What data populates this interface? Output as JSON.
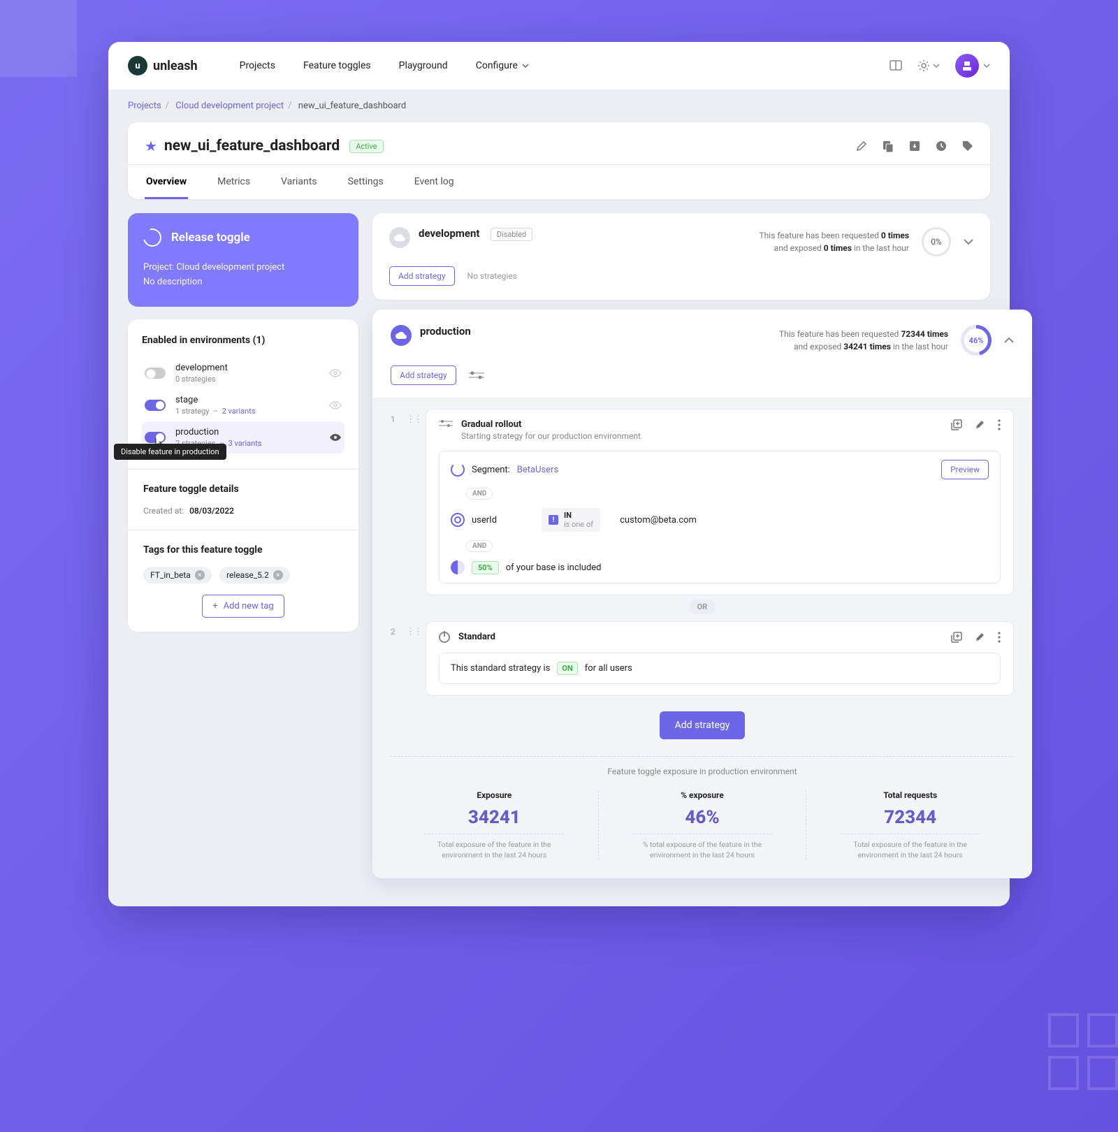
{
  "brand": "unleash",
  "nav": {
    "projects": "Projects",
    "toggles": "Feature toggles",
    "playground": "Playground",
    "configure": "Configure"
  },
  "crumbs": {
    "a": "Projects",
    "b": "Cloud development project",
    "c": "new_ui_feature_dashboard"
  },
  "feature": {
    "name": "new_ui_feature_dashboard",
    "status": "Active"
  },
  "tabs": {
    "overview": "Overview",
    "metrics": "Metrics",
    "variants": "Variants",
    "settings": "Settings",
    "eventlog": "Event log"
  },
  "release": {
    "title": "Release toggle",
    "project_label": "Project:",
    "project": "Cloud development project",
    "desc": "No description"
  },
  "envs": {
    "heading_prefix": "Enabled in environments",
    "count": "1",
    "items": [
      {
        "name": "development",
        "sub": "0 strategies",
        "on": false
      },
      {
        "name": "stage",
        "sub": "1 strategy",
        "variants": "2 variants",
        "on": true
      },
      {
        "name": "production",
        "sub": "2 strategies",
        "variants": "3 variants",
        "on": true
      }
    ],
    "tooltip": "Disable feature in production"
  },
  "details": {
    "heading": "Feature toggle details",
    "created_label": "Created at:",
    "created": "08/03/2022"
  },
  "tags": {
    "heading": "Tags for this feature toggle",
    "items": [
      "FT_in_beta",
      "release_5.2"
    ],
    "add": "Add new tag"
  },
  "devPanel": {
    "name": "development",
    "disabled": "Disabled",
    "add": "Add strategy",
    "none": "No strategies",
    "req1a": "This feature has been requested ",
    "req1b": "0 times",
    "req2a": "and exposed ",
    "req2b": "0 times",
    "req2c": " in the last hour",
    "pct": "0%"
  },
  "prodPanel": {
    "name": "production",
    "add": "Add strategy",
    "req1a": "This feature has been requested ",
    "req1b": "72344 times",
    "req2a": "and exposed ",
    "req2b": "34241 times",
    "req2c": " in the last hour",
    "pct": "46%"
  },
  "strat1": {
    "name": "Gradual rollout",
    "sub": "Starting strategy for our production environment",
    "segment_label": "Segment:",
    "segment": "BetaUsers",
    "preview": "Preview",
    "and": "AND",
    "constraint_field": "userId",
    "in": "IN",
    "in_sub": "is one of",
    "value": "custom@beta.com",
    "rollout_pct": "50%",
    "rollout_text": "of your base is included",
    "or": "OR"
  },
  "strat2": {
    "name": "Standard",
    "text1": "This standard strategy is",
    "on": "ON",
    "text2": "for all users"
  },
  "addStrategy": "Add strategy",
  "exposure": {
    "title": "Feature toggle exposure in production environment",
    "c1": {
      "label": "Exposure",
      "val": "34241",
      "sub": "Total exposure of the feature in the environment in the last 24 hours"
    },
    "c2": {
      "label": "% exposure",
      "val": "46%",
      "sub": "% total exposure of the feature in the environment in the last 24 hours"
    },
    "c3": {
      "label": "Total requests",
      "val": "72344",
      "sub": "Total exposure of the feature in the environment in the last 24 hours"
    }
  }
}
